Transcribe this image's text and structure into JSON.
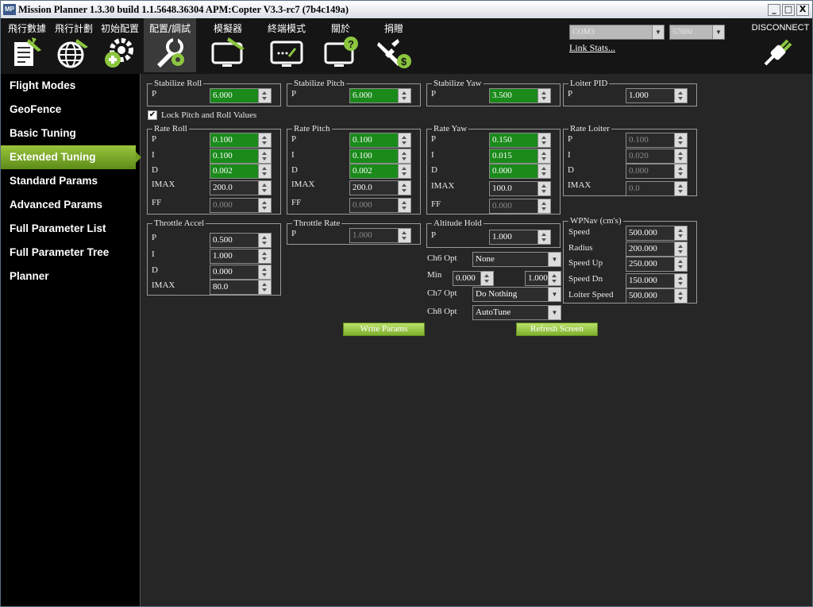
{
  "window": {
    "title": "Mission Planner 1.3.30 build 1.1.5648.36304 APM:Copter V3.3-rc7 (7b4c149a)",
    "logo": "MP",
    "minimize": "_",
    "maximize": "□",
    "close": "X"
  },
  "menu": [
    {
      "label": "飛行數據",
      "icon": "flight-data-icon"
    },
    {
      "label": "飛行計劃",
      "icon": "flight-plan-icon"
    },
    {
      "label": "初始配置",
      "icon": "initial-setup-icon"
    },
    {
      "label": "配置/調試",
      "icon": "config-tuning-icon"
    },
    {
      "label": "模擬器",
      "icon": "simulation-icon"
    },
    {
      "label": "終端模式",
      "icon": "terminal-icon"
    },
    {
      "label": "關於",
      "icon": "help-icon"
    },
    {
      "label": "捐贈",
      "icon": "donate-icon"
    }
  ],
  "connection": {
    "port": "COM3",
    "baud": "57600",
    "link_stats": "Link Stats...",
    "disconnect": "DISCONNECT"
  },
  "sidebar": {
    "items": [
      "Flight Modes",
      "GeoFence",
      "Basic Tuning",
      "Extended Tuning",
      "Standard Params",
      "Advanced Params",
      "Full Parameter List",
      "Full Parameter Tree",
      "Planner"
    ],
    "active": "Extended Tuning"
  },
  "stab_roll": {
    "title": "Stabilize Roll",
    "p_label": "P",
    "p": "6.000"
  },
  "stab_pitch": {
    "title": "Stabilize Pitch",
    "p_label": "P",
    "p": "6.000"
  },
  "stab_yaw": {
    "title": "Stabilize Yaw",
    "p_label": "P",
    "p": "3.500"
  },
  "loiter_pid": {
    "title": "Loiter PID",
    "p_label": "P",
    "p": "1.000"
  },
  "lock": {
    "label": "Lock Pitch and Roll Values",
    "check": "✔"
  },
  "rate_roll": {
    "title": "Rate Roll",
    "labels": [
      "P",
      "I",
      "D",
      "IMAX",
      "FF"
    ],
    "values": [
      "0.100",
      "0.100",
      "0.002",
      "200.0",
      "0.000"
    ]
  },
  "rate_pitch": {
    "title": "Rate Pitch",
    "labels": [
      "P",
      "I",
      "D",
      "IMAX",
      "FF"
    ],
    "values": [
      "0.100",
      "0.100",
      "0.002",
      "200.0",
      "0.000"
    ]
  },
  "rate_yaw": {
    "title": "Rate Yaw",
    "labels": [
      "P",
      "I",
      "D",
      "IMAX",
      "FF"
    ],
    "values": [
      "0.150",
      "0.015",
      "0.000",
      "100.0",
      "0.000"
    ]
  },
  "rate_loiter": {
    "title": "Rate Loiter",
    "labels": [
      "P",
      "I",
      "D",
      "IMAX"
    ],
    "values": [
      "0.100",
      "0.020",
      "0.000",
      "0.0"
    ]
  },
  "throttle_accel": {
    "title": "Throttle Accel",
    "labels": [
      "P",
      "I",
      "D",
      "IMAX"
    ],
    "values": [
      "0.500",
      "1.000",
      "0.000",
      "80.0"
    ]
  },
  "throttle_rate": {
    "title": "Throttle Rate",
    "p_label": "P",
    "p": "1.000"
  },
  "alt_hold": {
    "title": "Altitude Hold",
    "p_label": "P",
    "p": "1.000"
  },
  "wpnav": {
    "title": "WPNav (cm's)",
    "labels": [
      "Speed",
      "Radius",
      "Speed Up",
      "Speed Dn",
      "Loiter Speed"
    ],
    "values": [
      "500.000",
      "200.000",
      "250.000",
      "150.000",
      "500.000"
    ]
  },
  "ch6": {
    "label": "Ch6 Opt",
    "value": "None",
    "min_label": "Min",
    "min": "0.000",
    "max": "1.000"
  },
  "ch7": {
    "label": "Ch7 Opt",
    "value": "Do Nothing"
  },
  "ch8": {
    "label": "Ch8 Opt",
    "value": "AutoTune"
  },
  "buttons": {
    "write": "Write Params",
    "refresh": "Refresh Screen"
  },
  "colors": {
    "accent_green": "#8cc63f",
    "field_green": "#1a8a1a",
    "toolbar": "#151515",
    "sidebar": "#000000",
    "background": "#262626"
  }
}
